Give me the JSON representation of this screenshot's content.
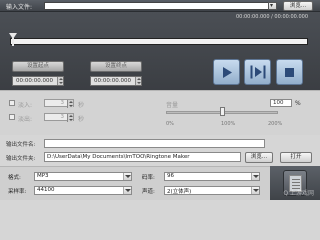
{
  "input": {
    "label": "输入文件:",
    "value": "",
    "browse_label": "浏览..."
  },
  "player": {
    "time_readout": "00:00:00.000 / 00:00:00.000",
    "set_start_label": "设置起点",
    "set_end_label": "设置终点",
    "start_time": "00:00:00.000",
    "end_time": "00:00:00.000",
    "progress_fraction": 0.0
  },
  "effects": {
    "fade_in_label": "淡入:",
    "fade_in_value": "3",
    "fade_in_unit": "秒",
    "fade_out_label": "淡出:",
    "fade_out_value": "3",
    "fade_out_unit": "秒",
    "volume_label": "音量",
    "volume_value": "100",
    "volume_unit": "%",
    "volume_fraction": 0.5,
    "vol_tick_0": "0%",
    "vol_tick_1": "100%",
    "vol_tick_2": "200%"
  },
  "output": {
    "name_label": "输出文件名:",
    "name_value": "",
    "folder_label": "输出文件夹:",
    "folder_value": "D:\\UserData\\My Documents\\ImTOO\\Ringtone Maker",
    "browse_label": "浏览...",
    "open_label": "打开"
  },
  "format": {
    "format_label": "格式:",
    "format_value": "MP3",
    "sample_rate_label": "采样率:",
    "sample_rate_value": "44100",
    "bitrate_label": "码率:",
    "bitrate_value": "96",
    "channels_label": "声道:",
    "channels_value": "2(立体声)"
  },
  "watermark": "Q 上游戏网"
}
